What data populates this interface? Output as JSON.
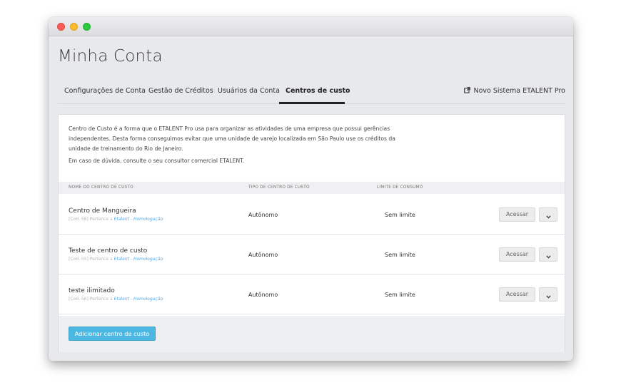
{
  "page": {
    "title": "Minha Conta"
  },
  "tabs": [
    {
      "label": "Configurações de Conta"
    },
    {
      "label": "Gestão de Créditos"
    },
    {
      "label": "Usuários da Conta"
    },
    {
      "label": "Centros de custo",
      "active": true
    }
  ],
  "external_link": {
    "label": "Novo Sistema ETALENT Pro",
    "icon": "external-link-icon"
  },
  "description": {
    "text": "Centro de Custo é a forma que o ETALENT Pro usa para organizar as atividades de uma empresa que possui gerências independentes. Desta forma conseguimos evitar que uma unidade de varejo localizada em São Paulo use os créditos da unidade de treinamento do Rio de Janeiro.",
    "help": "Em caso de dúvida, consulte o seu consultor comercial ETALENT."
  },
  "table": {
    "headers": [
      "Nome do centro de custo",
      "Tipo de centro de custo",
      "Limite de consumo"
    ],
    "rows": [
      {
        "name": "Centro de Mangueira",
        "code": "[Cod. 58] Pertence a",
        "org": "Etalent - Homologação",
        "type": "Autônomo",
        "limit": "Sem limite",
        "action": "Acessar"
      },
      {
        "name": "Teste de centro de custo",
        "code": "[Cod. 55] Pertence a",
        "org": "Etalent - Homologação",
        "type": "Autônomo",
        "limit": "Sem limite",
        "action": "Acessar"
      },
      {
        "name": "teste ilimitado",
        "code": "[Cod. 56] Pertence a",
        "org": "Etalent - Homologação",
        "type": "Autônomo",
        "limit": "Sem limite",
        "action": "Acessar"
      }
    ]
  },
  "footer": {
    "add_button": "Adicionar centro de custo"
  },
  "colors": {
    "accent": "#4bb8e2",
    "link": "#5aa9e0"
  }
}
